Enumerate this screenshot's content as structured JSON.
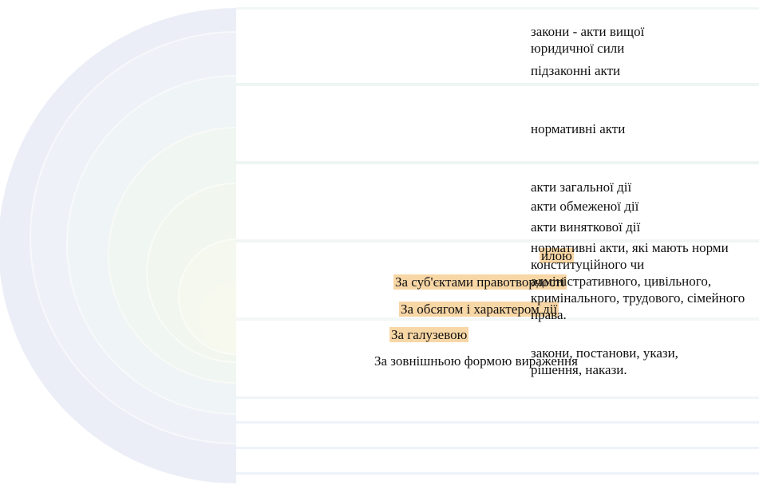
{
  "colors": {
    "highlight": "#f8d7a6",
    "outer_arc": "#e6e9f5",
    "inner_arc": "#eef5ea",
    "band_line": "#eaf4f4"
  },
  "categories": {
    "subjects": "За суб'єктами правотворчості",
    "scope_character": "За обсягом і характером дії",
    "branch": "За галузевою",
    "form": "За зовнішньою формою вираження",
    "force_fragment": "илою"
  },
  "items": {
    "laws_higher_force": "закони - акти вищої юридичної сили",
    "bylaws": "підзаконні акти",
    "normative_acts": "нормативні акти",
    "general_acts": "акти загальної дії",
    "limited_acts": "акти обмеженої дії",
    "exceptional_acts": "акти виняткової дії",
    "branch_norms": "нормативні акти, які мають норми конституційного чи адміністративного, цивільного, кримінального, трудового, сімейного права.",
    "form_list": "закони, постанови, укази, рішення, накази."
  }
}
